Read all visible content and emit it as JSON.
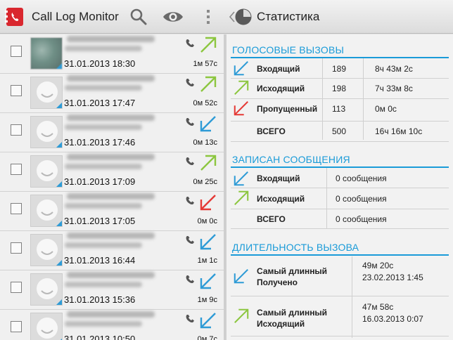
{
  "app": {
    "title": "Call Log Monitor",
    "panel_title": "Статистика"
  },
  "calls": [
    {
      "date": "31.01.2013 18:30",
      "duration": "1м 57с",
      "direction": "outgoing",
      "photo": true
    },
    {
      "date": "31.01.2013 17:47",
      "duration": "0м 52с",
      "direction": "outgoing",
      "photo": false
    },
    {
      "date": "31.01.2013 17:46",
      "duration": "0м 13с",
      "direction": "incoming",
      "photo": false
    },
    {
      "date": "31.01.2013 17:09",
      "duration": "0м 25с",
      "direction": "outgoing",
      "photo": false
    },
    {
      "date": "31.01.2013 17:05",
      "duration": "0м 0с",
      "direction": "missed",
      "photo": false
    },
    {
      "date": "31.01.2013 16:44",
      "duration": "1м 1с",
      "direction": "incoming",
      "photo": false
    },
    {
      "date": "31.01.2013 15:36",
      "duration": "1м 9с",
      "direction": "incoming",
      "photo": false
    },
    {
      "date": "31.01.2013 10:50",
      "duration": "0м 7с",
      "direction": "incoming",
      "photo": false
    }
  ],
  "voice": {
    "heading": "ГОЛОСОВЫЕ ВЫЗОВЫ",
    "rows": [
      {
        "label": "Входящий",
        "count": "189",
        "time": "8ч 43м 2с",
        "direction": "incoming"
      },
      {
        "label": "Исходящий",
        "count": "198",
        "time": "7ч 33м 8с",
        "direction": "outgoing"
      },
      {
        "label": "Пропущенный",
        "count": "113",
        "time": "0м 0с",
        "direction": "missed"
      }
    ],
    "total": {
      "label": "ВСЕГО",
      "count": "500",
      "time": "16ч 16м 10с"
    }
  },
  "messages": {
    "heading": "ЗАПИСАН СООБЩЕНИЯ",
    "rows": [
      {
        "label": "Входящий",
        "value": "0 сообщения",
        "direction": "incoming"
      },
      {
        "label": "Исходящий",
        "value": "0 сообщения",
        "direction": "outgoing"
      }
    ],
    "total": {
      "label": "ВСЕГО",
      "value": "0 сообщения"
    }
  },
  "duration": {
    "heading": "ДЛИТЕЛЬНОСТЬ ВЫЗОВА",
    "rows": [
      {
        "label1": "Самый длинный",
        "label2": "Получено",
        "value": "49м 20с",
        "date": "23.02.2013 1:45",
        "direction": "incoming"
      },
      {
        "label1": "Самый длинный",
        "label2": "Исходящий",
        "value": "47м 58с",
        "date": "16.03.2013 0:07",
        "direction": "outgoing"
      }
    ]
  },
  "colors": {
    "incoming": "#2e9bd6",
    "outgoing": "#8cc63f",
    "missed": "#e53935",
    "accent": "#1a9bd8",
    "logo": "#d9272e"
  },
  "icons": [
    "app-logo-icon",
    "search-icon",
    "eye-icon",
    "overflow-menu-icon",
    "up-chevron-icon",
    "pie-chart-icon",
    "checkbox-icon",
    "contact-avatar-icon",
    "handset-icon",
    "incoming-arrow-icon",
    "outgoing-arrow-icon",
    "missed-arrow-icon"
  ]
}
